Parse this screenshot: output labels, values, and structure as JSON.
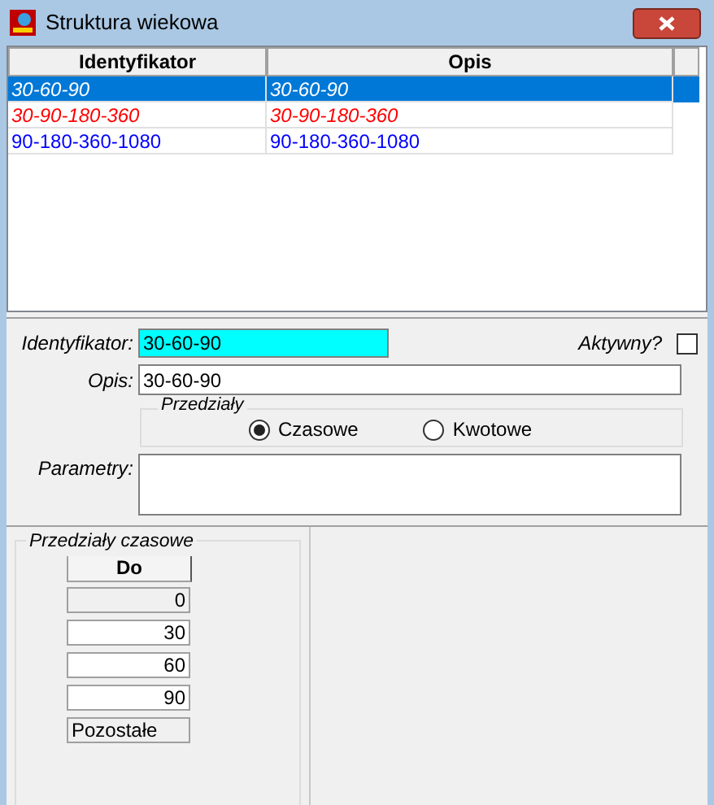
{
  "window": {
    "title": "Struktura wiekowa"
  },
  "table": {
    "columns": [
      "Identyfikator",
      "Opis"
    ],
    "rows": [
      {
        "cells": [
          "30-60-90",
          "30-60-90"
        ],
        "selected": true,
        "italic": true
      },
      {
        "cells": [
          "30-90-180-360",
          "30-90-180-360"
        ],
        "selected": false,
        "italic": true,
        "color": "#ff0000"
      },
      {
        "cells": [
          "90-180-360-1080",
          "90-180-360-1080"
        ],
        "selected": false,
        "italic": false,
        "color": "#0000ff"
      }
    ]
  },
  "form": {
    "identyfikator_label": "Identyfikator:",
    "identyfikator": "30-60-90",
    "aktywny_label": "Aktywny?",
    "aktywny_checked": false,
    "opis_label": "Opis:",
    "opis": "30-60-90",
    "przedzialy_label": "Przedziały",
    "radios": [
      {
        "label": "Czasowe",
        "selected": true
      },
      {
        "label": "Kwotowe",
        "selected": false
      }
    ],
    "parametry_label": "Parametry:"
  },
  "intervals": {
    "title": "Przedziały czasowe",
    "column": "Do",
    "rows": [
      {
        "value": "0",
        "kind": "readonly"
      },
      {
        "value": "30",
        "kind": "input"
      },
      {
        "value": "60",
        "kind": "input"
      },
      {
        "value": "90",
        "kind": "input"
      },
      {
        "value": "Pozostałe",
        "kind": "rest"
      }
    ]
  }
}
